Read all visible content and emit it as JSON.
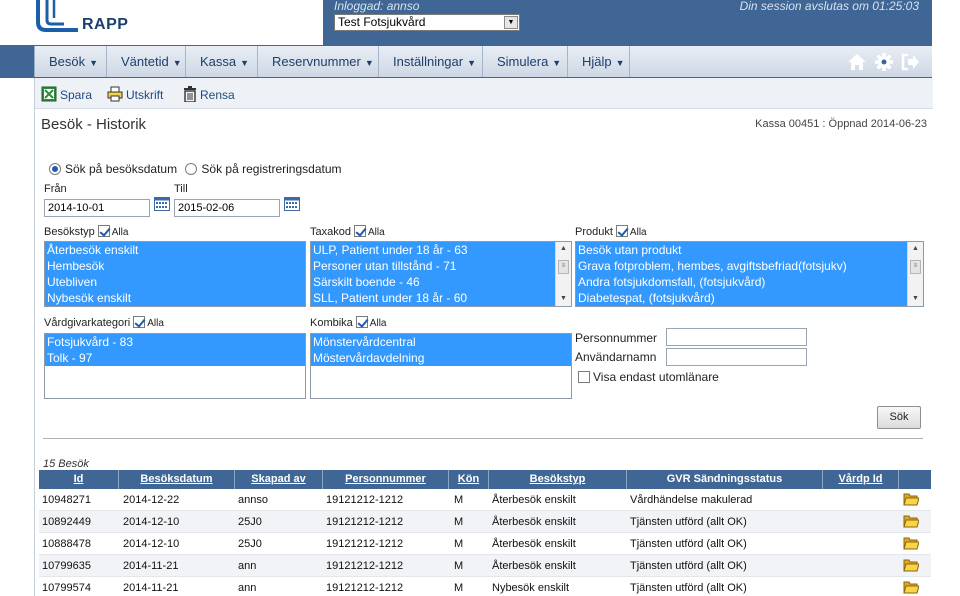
{
  "header": {
    "logo_text": "RAPP",
    "logged_in": "Inloggad: annso",
    "unit": "Test Fotsjukvård",
    "session": "Din session avslutas om 01:25:03"
  },
  "nav": {
    "items": [
      {
        "label": "Besök"
      },
      {
        "label": "Väntetid"
      },
      {
        "label": "Kassa"
      },
      {
        "label": "Reservnummer"
      },
      {
        "label": "Inställningar"
      },
      {
        "label": "Simulera"
      },
      {
        "label": "Hjälp"
      }
    ],
    "caret": "▼"
  },
  "toolbar": {
    "save": "Spara",
    "print": "Utskrift",
    "clear": "Rensa"
  },
  "page": {
    "title": "Besök - Historik",
    "kassa_info": "Kassa 00451 : Öppnad 2014-06-23"
  },
  "search": {
    "radio_visit_date": "Sök på besöksdatum",
    "radio_reg_date": "Sök på registreringsdatum",
    "from_label": "Från",
    "to_label": "Till",
    "from_value": "2014-10-01",
    "to_value": "2015-02-06",
    "all_label": "Alla",
    "visit_type_label": "Besökstyp",
    "visit_types": [
      "Återbesök enskilt",
      "Hembesök",
      "Utebliven",
      "Nybesök enskilt"
    ],
    "taxa_label": "Taxakod",
    "taxa_codes": [
      "ULP, Patient under 18 år - 63",
      "Personer utan tillstånd - 71",
      "Särskilt boende - 46",
      "SLL, Patient under 18 år - 60"
    ],
    "product_label": "Produkt",
    "products": [
      "Besök utan produkt",
      "Grava fotproblem, hembes, avgiftsbefriad(fotsjukv)",
      "Andra fotsjukdomsfall, (fotsjukvård)",
      "Diabetespat, (fotsjukvård)"
    ],
    "caregiver_label": "Vårdgivarkategori",
    "caregivers": [
      "Fotsjukvård - 83",
      "Tolk - 97"
    ],
    "kombika_label": "Kombika",
    "kombikas": [
      "Mönstervårdcentral",
      "Möstervårdavdelning"
    ],
    "pnr_label": "Personnummer",
    "user_label": "Användarnamn",
    "outside_label": "Visa endast utomlänare",
    "search_button": "Sök"
  },
  "results": {
    "count": "15 Besök",
    "columns": [
      "Id",
      "Besöksdatum",
      "Skapad av",
      "Personnummer",
      "Kön",
      "Besökstyp",
      "GVR Sändningsstatus",
      "Vårdp Id"
    ],
    "rows": [
      {
        "id": "10948271",
        "date": "2014-12-22",
        "created_by": "annso",
        "pnr": "19121212-1212",
        "sex": "M",
        "type": "Återbesök enskilt",
        "status": "Vårdhändelse makulerad",
        "vardp": ""
      },
      {
        "id": "10892449",
        "date": "2014-12-10",
        "created_by": "25J0",
        "pnr": "19121212-1212",
        "sex": "M",
        "type": "Återbesök enskilt",
        "status": "Tjänsten utförd (allt OK)",
        "vardp": ""
      },
      {
        "id": "10888478",
        "date": "2014-12-10",
        "created_by": "25J0",
        "pnr": "19121212-1212",
        "sex": "M",
        "type": "Återbesök enskilt",
        "status": "Tjänsten utförd (allt OK)",
        "vardp": ""
      },
      {
        "id": "10799635",
        "date": "2014-11-21",
        "created_by": "ann",
        "pnr": "19121212-1212",
        "sex": "M",
        "type": "Återbesök enskilt",
        "status": "Tjänsten utförd (allt OK)",
        "vardp": ""
      },
      {
        "id": "10799574",
        "date": "2014-11-21",
        "created_by": "ann",
        "pnr": "19121212-1212",
        "sex": "M",
        "type": "Nybesök enskilt",
        "status": "Tjänsten utförd (allt OK)",
        "vardp": ""
      }
    ]
  },
  "colors": {
    "brand": "#3f6694",
    "selection": "#3399ff",
    "folder": "#f2c12e"
  }
}
